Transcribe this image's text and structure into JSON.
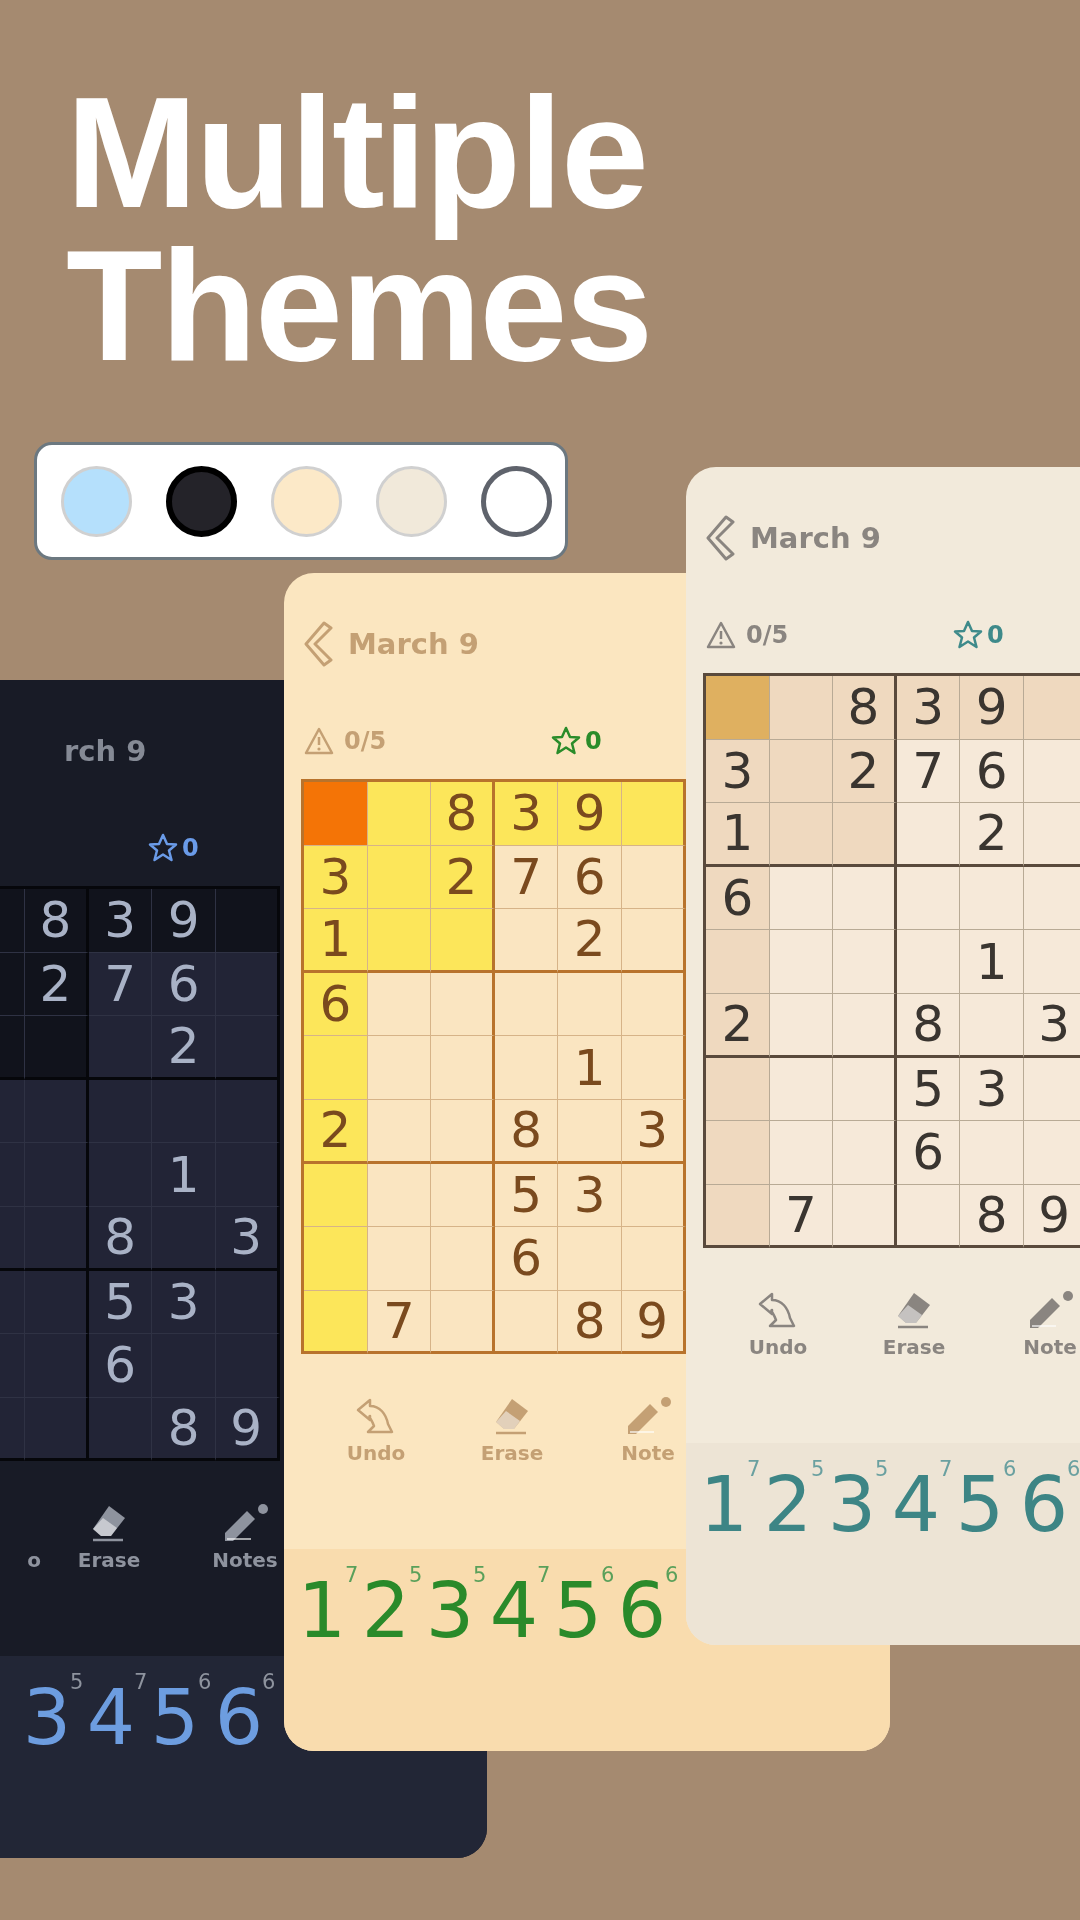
{
  "headline": "Multiple Themes",
  "theme_swatches": [
    {
      "color": "#b5e0fc"
    },
    {
      "color": "#242329"
    },
    {
      "color": "#fce9c8"
    },
    {
      "color": "#f1e9da"
    },
    {
      "color": "#ffffff"
    }
  ],
  "phones": [
    {
      "kind": "dark",
      "title": "rch 9",
      "score": "0",
      "grid": [
        [
          {
            "selected": false,
            "highlighted": true
          },
          {
            "digit": "8",
            "selected": false,
            "highlighted": true
          },
          {
            "digit": "3",
            "selected": false,
            "highlighted": true
          },
          {
            "digit": "9",
            "selected": false,
            "highlighted": true
          },
          {
            "selected": false,
            "highlighted": true
          }
        ],
        [
          {
            "selected": false,
            "highlighted": true
          },
          {
            "digit": "2",
            "selected": false,
            "highlighted": true
          },
          {
            "digit": "7",
            "selected": false,
            "highlighted": false
          },
          {
            "digit": "6",
            "selected": false,
            "highlighted": false
          },
          {
            "selected": false,
            "highlighted": false
          }
        ],
        [
          {
            "selected": false,
            "highlighted": true
          },
          {
            "selected": false,
            "highlighted": true
          },
          {
            "selected": false,
            "highlighted": false
          },
          {
            "digit": "2",
            "selected": false,
            "highlighted": false
          },
          {
            "selected": false,
            "highlighted": false
          }
        ],
        [
          {
            "selected": false,
            "highlighted": false
          },
          {
            "selected": false,
            "highlighted": false
          },
          {
            "selected": false,
            "highlighted": false
          },
          {
            "selected": false,
            "highlighted": false
          },
          {
            "selected": false,
            "highlighted": false
          }
        ],
        [
          {
            "selected": false,
            "highlighted": false
          },
          {
            "selected": false,
            "highlighted": false
          },
          {
            "selected": false,
            "highlighted": false
          },
          {
            "digit": "1",
            "selected": false,
            "highlighted": false
          },
          {
            "selected": false,
            "highlighted": false
          }
        ],
        [
          {
            "selected": false,
            "highlighted": false
          },
          {
            "selected": false,
            "highlighted": false
          },
          {
            "digit": "8",
            "selected": false,
            "highlighted": false
          },
          {
            "selected": false,
            "highlighted": false
          },
          {
            "digit": "3",
            "selected": false,
            "highlighted": false
          }
        ],
        [
          {
            "selected": false,
            "highlighted": false
          },
          {
            "selected": false,
            "highlighted": false
          },
          {
            "digit": "5",
            "selected": false,
            "highlighted": false
          },
          {
            "digit": "3",
            "selected": false,
            "highlighted": false
          },
          {
            "selected": false,
            "highlighted": false
          }
        ],
        [
          {
            "selected": false,
            "highlighted": false
          },
          {
            "selected": false,
            "highlighted": false
          },
          {
            "digit": "6",
            "selected": false,
            "highlighted": false
          },
          {
            "selected": false,
            "highlighted": false
          },
          {
            "selected": false,
            "highlighted": false
          }
        ],
        [
          {
            "selected": false,
            "highlighted": false
          },
          {
            "selected": false,
            "highlighted": false
          },
          {
            "selected": false,
            "highlighted": false
          },
          {
            "digit": "8",
            "selected": false,
            "highlighted": false
          },
          {
            "digit": "9",
            "selected": false,
            "highlighted": false
          }
        ]
      ],
      "tools": [
        {
          "kind": "text",
          "label": "o"
        },
        {
          "kind": "erase",
          "label": "Erase"
        },
        {
          "kind": "notes",
          "label": "Notes"
        }
      ],
      "numbers": [
        {
          "digit": "3",
          "remaining": "5"
        },
        {
          "digit": "4",
          "remaining": "7"
        },
        {
          "digit": "5",
          "remaining": "6"
        },
        {
          "digit": "6",
          "remaining": "6"
        }
      ]
    },
    {
      "kind": "yellow",
      "title": "March 9",
      "mistakes": "0/5",
      "score": "0",
      "grid": [
        [
          {
            "selected": true
          },
          {
            "selected": false,
            "highlighted": true
          },
          {
            "digit": "8",
            "selected": false,
            "highlighted": true
          },
          {
            "digit": "3",
            "selected": false,
            "highlighted": true
          },
          {
            "digit": "9",
            "selected": false,
            "highlighted": true
          },
          {
            "selected": false,
            "highlighted": true
          }
        ],
        [
          {
            "digit": "3",
            "selected": false,
            "highlighted": true
          },
          {
            "selected": false,
            "highlighted": true
          },
          {
            "digit": "2",
            "selected": false,
            "highlighted": true
          },
          {
            "digit": "7",
            "selected": false,
            "highlighted": false
          },
          {
            "digit": "6",
            "selected": false,
            "highlighted": false
          },
          {
            "selected": false,
            "highlighted": false
          }
        ],
        [
          {
            "digit": "1",
            "selected": false,
            "highlighted": true
          },
          {
            "selected": false,
            "highlighted": true
          },
          {
            "selected": false,
            "highlighted": true
          },
          {
            "selected": false,
            "highlighted": false
          },
          {
            "digit": "2",
            "selected": false,
            "highlighted": false
          },
          {
            "selected": false,
            "highlighted": false
          }
        ],
        [
          {
            "digit": "6",
            "selected": false,
            "highlighted": true
          },
          {
            "selected": false,
            "highlighted": false
          },
          {
            "selected": false,
            "highlighted": false
          },
          {
            "selected": false,
            "highlighted": false
          },
          {
            "selected": false,
            "highlighted": false
          },
          {
            "selected": false,
            "highlighted": false
          }
        ],
        [
          {
            "selected": false,
            "highlighted": true
          },
          {
            "selected": false,
            "highlighted": false
          },
          {
            "selected": false,
            "highlighted": false
          },
          {
            "selected": false,
            "highlighted": false
          },
          {
            "digit": "1",
            "selected": false,
            "highlighted": false
          },
          {
            "selected": false,
            "highlighted": false
          }
        ],
        [
          {
            "digit": "2",
            "selected": false,
            "highlighted": true
          },
          {
            "selected": false,
            "highlighted": false
          },
          {
            "selected": false,
            "highlighted": false
          },
          {
            "digit": "8",
            "selected": false,
            "highlighted": false
          },
          {
            "selected": false,
            "highlighted": false
          },
          {
            "digit": "3",
            "selected": false,
            "highlighted": false
          }
        ],
        [
          {
            "selected": false,
            "highlighted": true
          },
          {
            "selected": false,
            "highlighted": false
          },
          {
            "selected": false,
            "highlighted": false
          },
          {
            "digit": "5",
            "selected": false,
            "highlighted": false
          },
          {
            "digit": "3",
            "selected": false,
            "highlighted": false
          },
          {
            "selected": false,
            "highlighted": false
          }
        ],
        [
          {
            "selected": false,
            "highlighted": true
          },
          {
            "selected": false,
            "highlighted": false
          },
          {
            "selected": false,
            "highlighted": false
          },
          {
            "digit": "6",
            "selected": false,
            "highlighted": false
          },
          {
            "selected": false,
            "highlighted": false
          },
          {
            "selected": false,
            "highlighted": false
          }
        ],
        [
          {
            "selected": false,
            "highlighted": true
          },
          {
            "digit": "7",
            "selected": false,
            "highlighted": false
          },
          {
            "selected": false,
            "highlighted": false
          },
          {
            "selected": false,
            "highlighted": false
          },
          {
            "digit": "8",
            "selected": false,
            "highlighted": false
          },
          {
            "digit": "9",
            "selected": false,
            "highlighted": false
          }
        ]
      ],
      "tools": [
        {
          "kind": "undo",
          "label": "Undo"
        },
        {
          "kind": "erase",
          "label": "Erase"
        },
        {
          "kind": "notes",
          "label": "Note"
        }
      ],
      "numbers": [
        {
          "digit": "1",
          "remaining": "7"
        },
        {
          "digit": "2",
          "remaining": "5"
        },
        {
          "digit": "3",
          "remaining": "5"
        },
        {
          "digit": "4",
          "remaining": "7"
        },
        {
          "digit": "5",
          "remaining": "6"
        },
        {
          "digit": "6",
          "remaining": "6"
        }
      ]
    },
    {
      "kind": "beige",
      "title": "March 9",
      "mistakes": "0/5",
      "score": "0",
      "grid": [
        [
          {
            "selected": true
          },
          {
            "selected": false,
            "highlighted": true
          },
          {
            "digit": "8",
            "selected": false,
            "highlighted": true
          },
          {
            "digit": "3",
            "selected": false,
            "highlighted": true
          },
          {
            "digit": "9",
            "selected": false,
            "highlighted": true
          },
          {
            "selected": false,
            "highlighted": true
          }
        ],
        [
          {
            "digit": "3",
            "selected": false,
            "highlighted": true
          },
          {
            "selected": false,
            "highlighted": true
          },
          {
            "digit": "2",
            "selected": false,
            "highlighted": true
          },
          {
            "digit": "7",
            "selected": false,
            "highlighted": false
          },
          {
            "digit": "6",
            "selected": false,
            "highlighted": false
          },
          {
            "selected": false,
            "highlighted": false
          }
        ],
        [
          {
            "digit": "1",
            "selected": false,
            "highlighted": true
          },
          {
            "selected": false,
            "highlighted": true
          },
          {
            "selected": false,
            "highlighted": true
          },
          {
            "selected": false,
            "highlighted": false
          },
          {
            "digit": "2",
            "selected": false,
            "highlighted": false
          },
          {
            "selected": false,
            "highlighted": false
          }
        ],
        [
          {
            "digit": "6",
            "selected": false,
            "highlighted": true
          },
          {
            "selected": false,
            "highlighted": false
          },
          {
            "selected": false,
            "highlighted": false
          },
          {
            "selected": false,
            "highlighted": false
          },
          {
            "selected": false,
            "highlighted": false
          },
          {
            "selected": false,
            "highlighted": false
          }
        ],
        [
          {
            "selected": false,
            "highlighted": true
          },
          {
            "selected": false,
            "highlighted": false
          },
          {
            "selected": false,
            "highlighted": false
          },
          {
            "selected": false,
            "highlighted": false
          },
          {
            "digit": "1",
            "selected": false,
            "highlighted": false
          },
          {
            "selected": false,
            "highlighted": false
          }
        ],
        [
          {
            "digit": "2",
            "selected": false,
            "highlighted": true
          },
          {
            "selected": false,
            "highlighted": false
          },
          {
            "selected": false,
            "highlighted": false
          },
          {
            "digit": "8",
            "selected": false,
            "highlighted": false
          },
          {
            "selected": false,
            "highlighted": false
          },
          {
            "digit": "3",
            "selected": false,
            "highlighted": false
          }
        ],
        [
          {
            "selected": false,
            "highlighted": true
          },
          {
            "selected": false,
            "highlighted": false
          },
          {
            "selected": false,
            "highlighted": false
          },
          {
            "digit": "5",
            "selected": false,
            "highlighted": false
          },
          {
            "digit": "3",
            "selected": false,
            "highlighted": false
          },
          {
            "selected": false,
            "highlighted": false
          }
        ],
        [
          {
            "selected": false,
            "highlighted": true
          },
          {
            "selected": false,
            "highlighted": false
          },
          {
            "selected": false,
            "highlighted": false
          },
          {
            "digit": "6",
            "selected": false,
            "highlighted": false
          },
          {
            "selected": false,
            "highlighted": false
          },
          {
            "selected": false,
            "highlighted": false
          }
        ],
        [
          {
            "selected": false,
            "highlighted": true
          },
          {
            "digit": "7",
            "selected": false,
            "highlighted": false
          },
          {
            "selected": false,
            "highlighted": false
          },
          {
            "selected": false,
            "highlighted": false
          },
          {
            "digit": "8",
            "selected": false,
            "highlighted": false
          },
          {
            "digit": "9",
            "selected": false,
            "highlighted": false
          }
        ]
      ],
      "tools": [
        {
          "kind": "undo",
          "label": "Undo"
        },
        {
          "kind": "erase",
          "label": "Erase"
        },
        {
          "kind": "notes",
          "label": "Note"
        }
      ],
      "numbers": [
        {
          "digit": "1",
          "remaining": "7"
        },
        {
          "digit": "2",
          "remaining": "5"
        },
        {
          "digit": "3",
          "remaining": "5"
        },
        {
          "digit": "4",
          "remaining": "7"
        },
        {
          "digit": "5",
          "remaining": "6"
        },
        {
          "digit": "6",
          "remaining": "6"
        }
      ]
    }
  ]
}
